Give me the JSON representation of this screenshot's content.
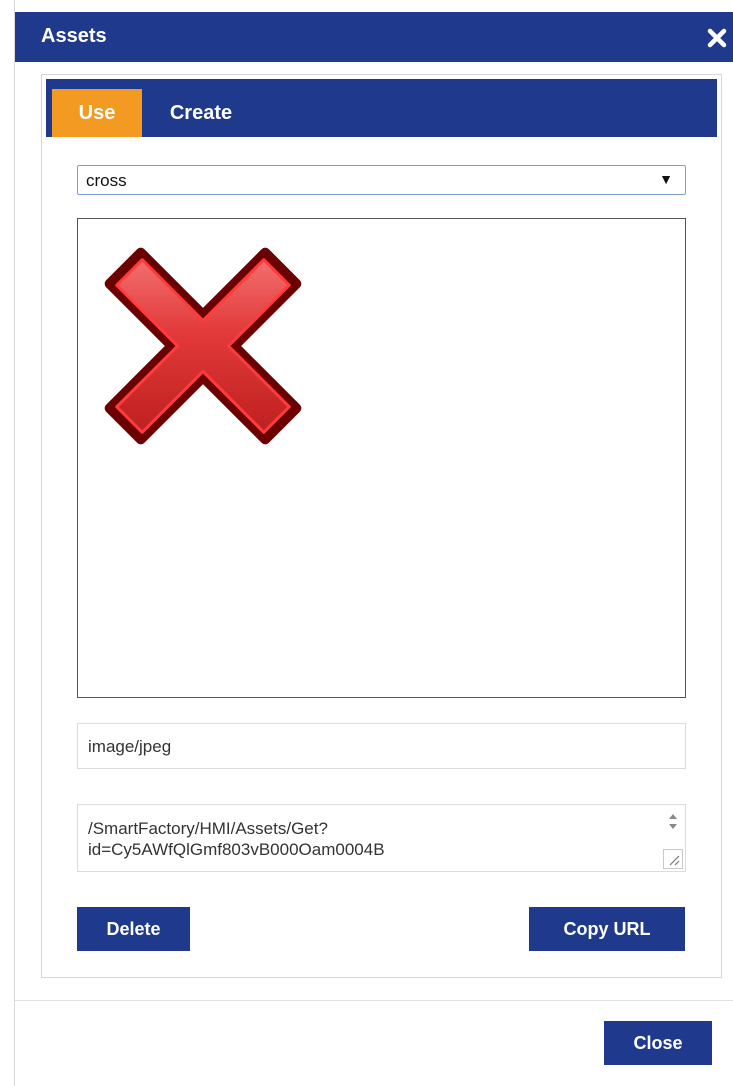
{
  "dialog": {
    "title": "Assets",
    "close_icon": "close-icon"
  },
  "tabs": [
    {
      "label": "Use",
      "active": true
    },
    {
      "label": "Create",
      "active": false
    }
  ],
  "asset_select": {
    "selected": "cross",
    "arrow": "▼"
  },
  "preview": {
    "icon": "red-cross-image"
  },
  "mime_type": "image/jpeg",
  "url": {
    "line1": "/SmartFactory/HMI/Assets/Get?",
    "line2": "id=Cy5AWfQlGmf803vB000Oam0004B"
  },
  "buttons": {
    "delete": "Delete",
    "copy_url": "Copy URL",
    "close": "Close"
  },
  "colors": {
    "header": "#1f3a8c",
    "active_tab": "#f39a22",
    "button": "#1f3a8c"
  }
}
